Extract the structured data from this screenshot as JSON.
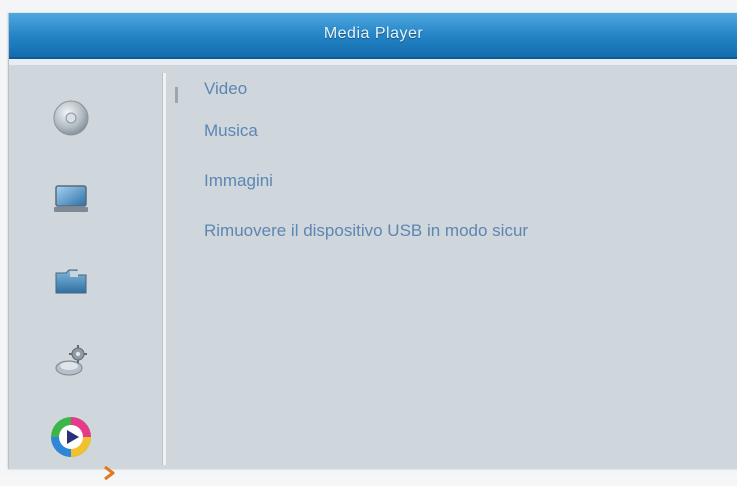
{
  "window": {
    "title": "Media Player"
  },
  "sidebar": {
    "items": [
      {
        "icon": "disc-icon"
      },
      {
        "icon": "monitor-icon"
      },
      {
        "icon": "folder-icon"
      },
      {
        "icon": "settings-icon"
      },
      {
        "icon": "media-player-icon",
        "active": true
      }
    ],
    "active_indicator_icon": "chevron-right-icon"
  },
  "menu": {
    "items": [
      {
        "label": "Video"
      },
      {
        "label": "Musica"
      },
      {
        "label": "Immagini"
      },
      {
        "label": "Rimuovere il dispositivo USB in modo sicur"
      }
    ]
  },
  "colors": {
    "title_bar": "#2585c7",
    "menu_text": "#5d86b3",
    "panel_bg": "#cfd6dc",
    "accent_arrow": "#e07a1e"
  }
}
